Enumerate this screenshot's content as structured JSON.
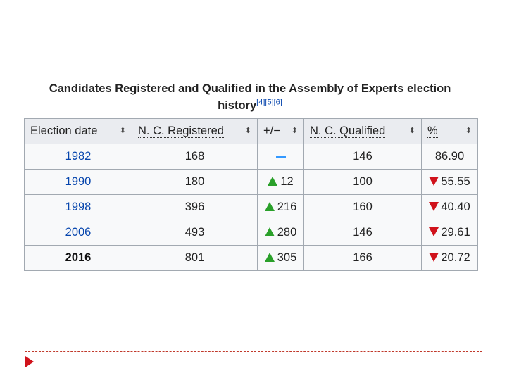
{
  "caption": {
    "text": "Candidates Registered and Qualified in the Assembly of Experts election history",
    "cites": "[4][5][6]"
  },
  "table": {
    "headers": [
      "Election date",
      "N. C. Registered",
      "+/−",
      "N. C. Qualified",
      "%"
    ],
    "rows": [
      {
        "date": "1982",
        "registered": "168",
        "change": "",
        "change_dir": "none",
        "qualified": "146",
        "percent": "86.90",
        "percent_dir": "none"
      },
      {
        "date": "1990",
        "registered": "180",
        "change": "12",
        "change_dir": "up",
        "qualified": "100",
        "percent": "55.55",
        "percent_dir": "down"
      },
      {
        "date": "1998",
        "registered": "396",
        "change": "216",
        "change_dir": "up",
        "qualified": "160",
        "percent": "40.40",
        "percent_dir": "down"
      },
      {
        "date": "2006",
        "registered": "493",
        "change": "280",
        "change_dir": "up",
        "qualified": "146",
        "percent": "29.61",
        "percent_dir": "down"
      },
      {
        "date": "2016",
        "registered": "801",
        "change": "305",
        "change_dir": "up",
        "qualified": "166",
        "percent": "20.72",
        "percent_dir": "down"
      }
    ]
  },
  "colors": {
    "link": "#0645ad",
    "up": "#2aa02a",
    "down": "#d0121b",
    "neutral": "#3399ff",
    "rule": "#c0392b",
    "bullet": "#d0121b"
  },
  "icons": {
    "sort": "sort-icon",
    "up": "up-triangle-icon",
    "down": "down-triangle-icon",
    "neutral": "dash-icon",
    "bullet": "bullet-arrow-icon"
  }
}
